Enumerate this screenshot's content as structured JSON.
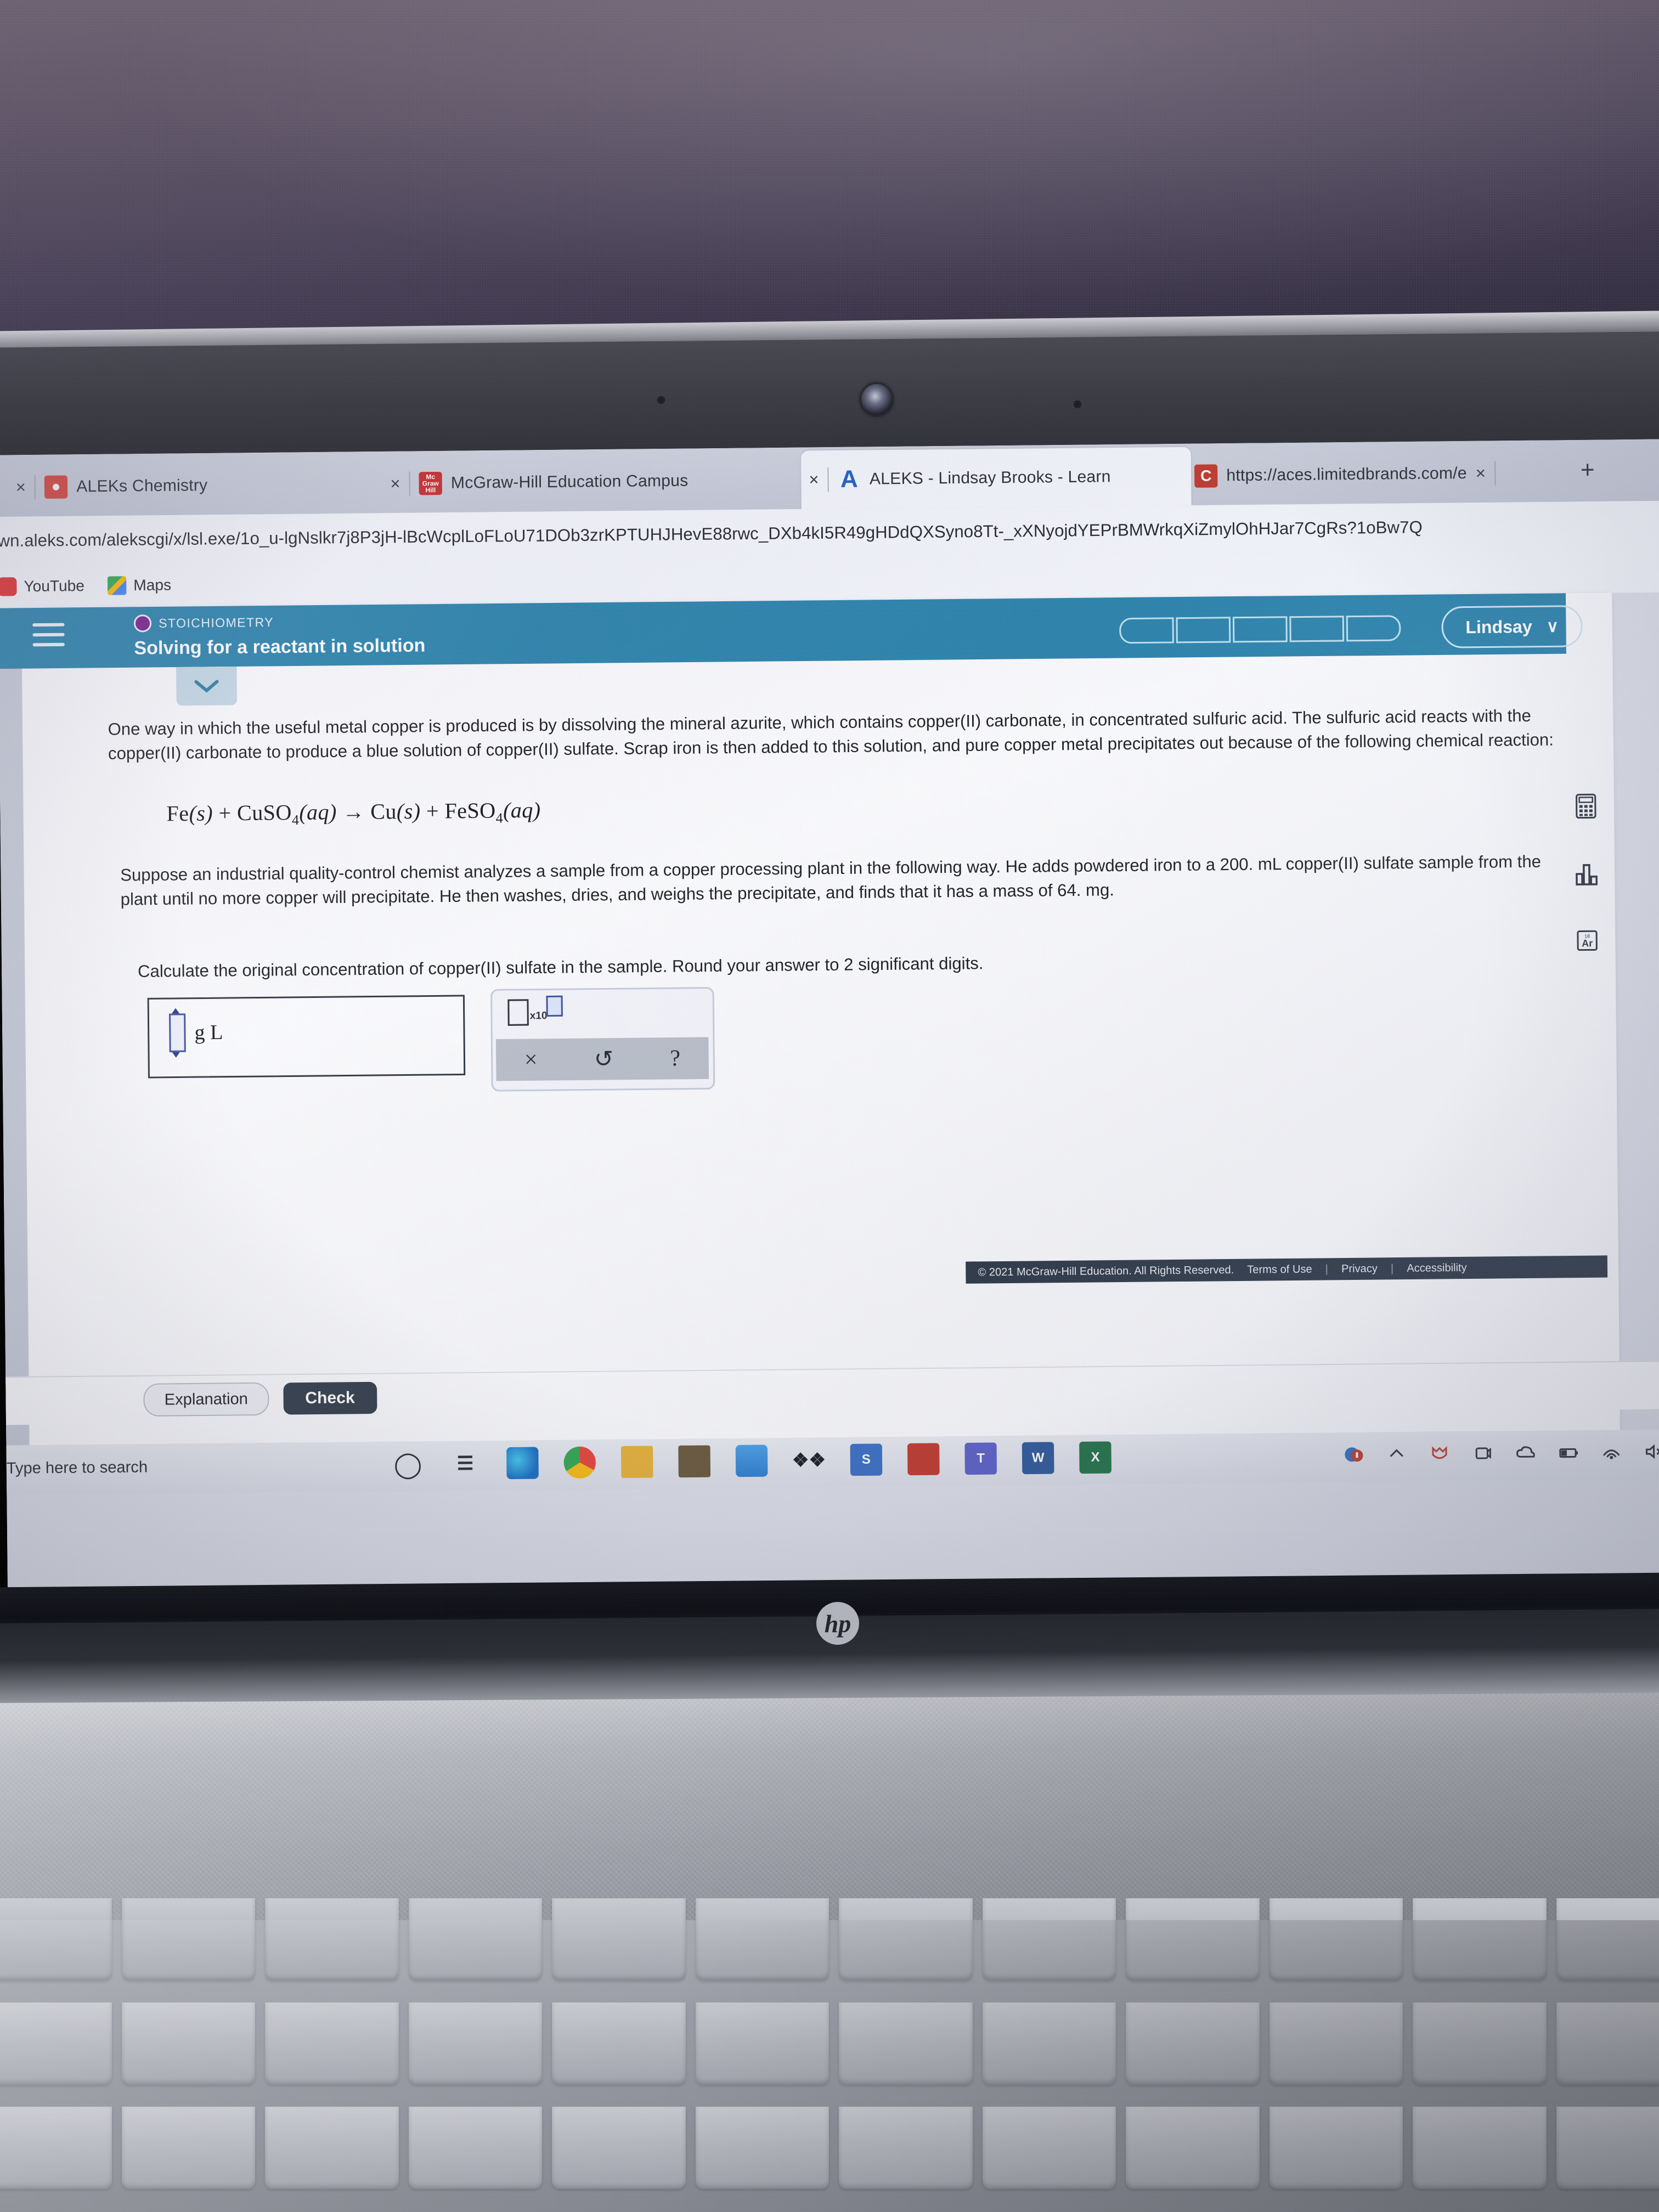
{
  "browser": {
    "tabs": [
      {
        "title": "ALEKs Chemistry",
        "favicon": "aleks-icon",
        "color": "#d8423a",
        "active": false
      },
      {
        "title": "McGraw-Hill Education Campus",
        "favicon": "mcgraw-hill-icon",
        "color": "#c62828",
        "letters": "Mc Graw Hill",
        "active": false
      },
      {
        "title": "ALEKS - Lindsay Brooks - Learn",
        "favicon": "aleks-a-icon",
        "color": "#1f5fbf",
        "letters": "A",
        "active": true
      },
      {
        "title": "https://aces.limitedbrands.com/e",
        "favicon": "aces-icon",
        "color": "#c0392b",
        "letters": "C",
        "active": false
      }
    ],
    "close_label": "×",
    "newtab_label": "+",
    "url": "wn.aleks.com/alekscgi/x/lsl.exe/1o_u-lgNslkr7j8P3jH-lBcWcplLoFLoU71DOb3zrKPTUHJHevE88rwc_DXb4kI5R49gHDdQXSyno8Tt-_xXNyojdYEPrBMWrkqXiZmylOhHJar7CgRs?1oBw7Q",
    "bookmarks": [
      {
        "label": "YouTube",
        "icon": "youtube-icon"
      },
      {
        "label": "Maps",
        "icon": "maps-icon"
      }
    ]
  },
  "aleks": {
    "breadcrumb": "STOICHIOMETRY",
    "title": "Solving for a reactant in solution",
    "user": "Lindsay",
    "user_chevron": "∨",
    "progress_segments": 5,
    "progress_filled": 0,
    "accent_color": "#2a82ab",
    "paragraph1": "One way in which the useful metal copper is produced is by dissolving the mineral azurite, which contains copper(II) carbonate, in concentrated sulfuric acid. The sulfuric acid reacts with the copper(II) carbonate to produce a blue solution of copper(II) sulfate. Scrap iron is then added to this solution, and pure copper metal precipitates out because of the following chemical reaction:",
    "equation": {
      "lhs": [
        "Fe(s)",
        "+",
        "CuSO",
        "4",
        "(aq)"
      ],
      "arrow": "→",
      "rhs": [
        "Cu(s)",
        "+",
        "FeSO",
        "4",
        "(aq)"
      ],
      "plain": "Fe(s) + CuSO4(aq) → Cu(s) + FeSO4(aq)"
    },
    "paragraph2": "Suppose an industrial quality-control chemist analyzes a sample from a copper processing plant in the following way. He adds powdered iron to a 200. mL copper(II) sulfate sample from the plant until no more copper will precipitate. He then washes, dries, and weighs the precipitate, and finds that it has a mass of 64. mg.",
    "paragraph3": "Calculate the original concentration of copper(II) sulfate in the sample. Round your answer to 2 significant digits.",
    "answer": {
      "value": "",
      "unit_numerator": "g",
      "unit_denominator": "L"
    },
    "toolpad": {
      "sci_notation_label": "x10",
      "clear_label": "×",
      "undo_label": "↺",
      "help_label": "?"
    },
    "right_tools": [
      {
        "name": "calculator-icon"
      },
      {
        "name": "bar-chart-icon"
      },
      {
        "name": "periodic-table-icon",
        "label": "Ar"
      }
    ],
    "buttons": {
      "explanation": "Explanation",
      "check": "Check"
    },
    "footer": {
      "copyright": "© 2021 McGraw-Hill Education. All Rights Reserved.",
      "links": [
        "Terms of Use",
        "Privacy",
        "Accessibility"
      ],
      "separator": "|"
    }
  },
  "taskbar": {
    "search_placeholder": "Type here to search",
    "icons": [
      {
        "name": "cortana-icon",
        "color": "#2b2d33",
        "glyph": "○"
      },
      {
        "name": "task-view-icon",
        "color": "#2b2d33",
        "glyph": "☰"
      },
      {
        "name": "edge-icon",
        "color": "#1a9ad7",
        "glyph": "e"
      },
      {
        "name": "chrome-icon",
        "color": "#e8c21d",
        "glyph": "◉"
      },
      {
        "name": "file-explorer-icon",
        "color": "#e8b23a",
        "glyph": "▭"
      },
      {
        "name": "store-icon",
        "color": "#6b5a3e",
        "glyph": "▤"
      },
      {
        "name": "mail-icon",
        "color": "#2f7fd0",
        "glyph": "✉"
      },
      {
        "name": "dropbox-icon",
        "color": "#1b1d23",
        "glyph": "❖"
      },
      {
        "name": "skype-icon",
        "color": "#3a6fc4",
        "glyph": "S"
      },
      {
        "name": "adobe-reader-icon",
        "color": "#c0392b",
        "glyph": "✒"
      },
      {
        "name": "teams-icon",
        "color": "#5b5fc7",
        "glyph": "T"
      },
      {
        "name": "word-icon",
        "color": "#2b579a",
        "glyph": "W"
      },
      {
        "name": "excel-icon",
        "color": "#1e7145",
        "glyph": "X"
      }
    ],
    "tray": [
      {
        "name": "notification-badge-icon"
      },
      {
        "name": "show-hidden-icons-chevron"
      },
      {
        "name": "firefox-shield-icon"
      },
      {
        "name": "onedrive-icon"
      },
      {
        "name": "cloud-icon"
      },
      {
        "name": "battery-icon"
      },
      {
        "name": "wifi-icon"
      },
      {
        "name": "volume-muted-icon"
      }
    ]
  },
  "device": {
    "brand": "hp"
  }
}
